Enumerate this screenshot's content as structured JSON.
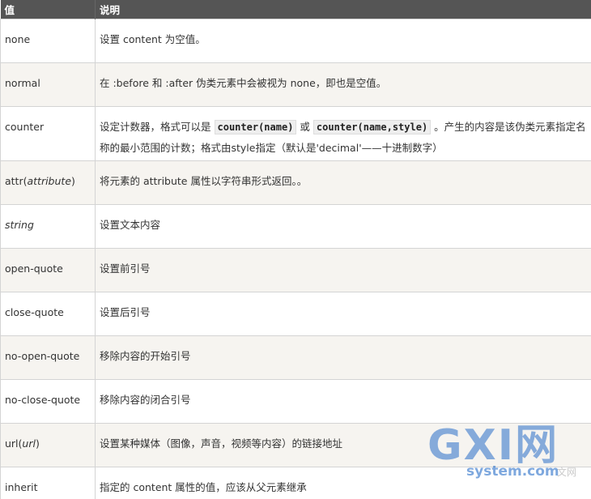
{
  "header": {
    "col_value": "值",
    "col_desc": "说明"
  },
  "rows": [
    {
      "value": "none",
      "desc": "设置 content 为空值。"
    },
    {
      "value": "normal",
      "desc": "在 :before 和 :after 伪类元素中会被视为 none，即也是空值。"
    },
    {
      "value": "counter",
      "desc_a": "设定计数器，格式可以是",
      "code_1": "counter(name)",
      "desc_b": "或",
      "code_2": "counter(name,style)",
      "desc_c": "。产生的内容是该伪类元素指定名称的最小范围的计数；格式由style指定（默认是'decimal'——十进制数字）"
    },
    {
      "value_a": "attr(",
      "value_b": "attribute",
      "value_c": ")",
      "desc": "将元素的 attribute 属性以字符串形式返回。。"
    },
    {
      "value": "string",
      "desc": "设置文本内容"
    },
    {
      "value": "open-quote",
      "desc": "设置前引号"
    },
    {
      "value": "close-quote",
      "desc": "设置后引号"
    },
    {
      "value": "no-open-quote",
      "desc": "移除内容的开始引号"
    },
    {
      "value": "no-close-quote",
      "desc": "移除内容的闭合引号"
    },
    {
      "value_a": "url(",
      "value_b": "url",
      "value_c": ")",
      "desc": "设置某种媒体（图像，声音，视频等内容）的链接地址"
    },
    {
      "value": "inherit",
      "desc": "指定的 content 属性的值，应该从父元素继承"
    }
  ],
  "watermark": {
    "big": "GXI网",
    "small": "system.com",
    "faint": "文网"
  }
}
